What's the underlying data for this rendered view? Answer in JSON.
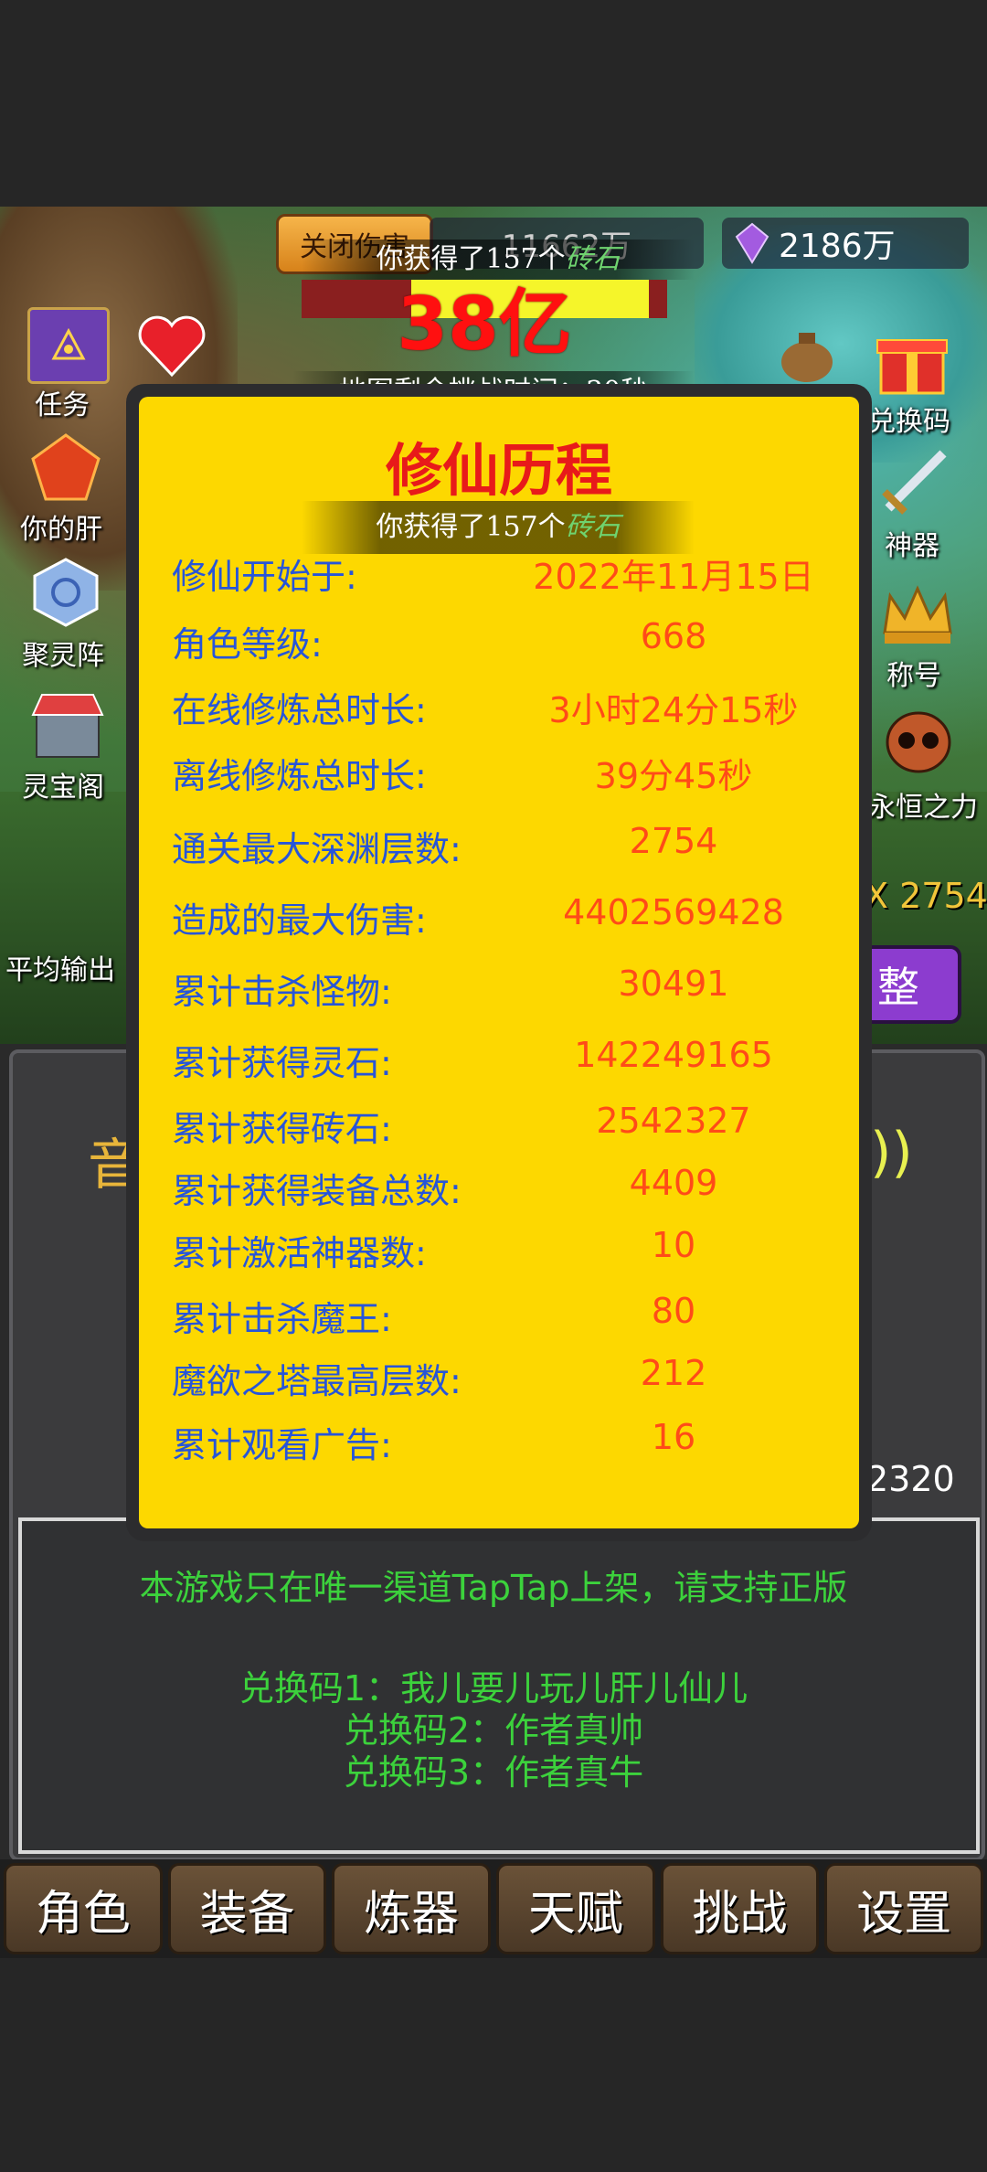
{
  "topbar": {
    "close_damage": "关闭伤害",
    "gold_value": "11662万",
    "gem_value": "2186万",
    "red_overlay_text": "38亿"
  },
  "toasts": {
    "gain_prefix": "你获得了157个",
    "gain_item": "砖石",
    "timer": "地图剩余挑战时间：30秒"
  },
  "left_menu": [
    {
      "label": "任务",
      "icon": "quest-book-icon"
    },
    {
      "label": "你的肝",
      "icon": "red-crystal-icon"
    },
    {
      "label": "聚灵阵",
      "icon": "spirit-array-icon"
    },
    {
      "label": "灵宝阁",
      "icon": "shop-icon"
    }
  ],
  "right_menu": [
    {
      "label": "兑换码",
      "icon": "gift-box-icon"
    },
    {
      "label": "神器",
      "icon": "sword-icon"
    },
    {
      "label": "称号",
      "icon": "crown-icon"
    },
    {
      "label": "永恒之力",
      "icon": "skull-icon"
    }
  ],
  "scene": {
    "avg_output": "平均输出",
    "layer_partial": "X 2754",
    "adjust_btn_partial": "整",
    "partial_number": "2320"
  },
  "modal": {
    "title": "修仙历程",
    "rows": [
      {
        "label": "修仙开始于:",
        "value": "2022年11月15日"
      },
      {
        "label": "角色等级:",
        "value": "668"
      },
      {
        "label": "在线修炼总时长:",
        "value": "3小时24分15秒"
      },
      {
        "label": "离线修炼总时长:",
        "value": "39分45秒"
      },
      {
        "label": "通关最大深渊层数:",
        "value": "2754"
      },
      {
        "label": "造成的最大伤害:",
        "value": "4402569428"
      },
      {
        "label": "累计击杀怪物:",
        "value": "30491"
      },
      {
        "label": "累计获得灵石:",
        "value": "142249165"
      },
      {
        "label": "累计获得砖石:",
        "value": "2542327"
      },
      {
        "label": "累计获得装备总数:",
        "value": "4409"
      },
      {
        "label": "累计激活神器数:",
        "value": "10"
      },
      {
        "label": "累计击杀魔王:",
        "value": "80"
      },
      {
        "label": "魔欲之塔最高层数:",
        "value": "212"
      },
      {
        "label": "累计观看广告:",
        "value": "16"
      }
    ]
  },
  "notice": {
    "line1": "本游戏只在唯一渠道TapTap上架，请支持正版",
    "code1": "兑换码1：我儿要儿玩儿肝儿仙儿",
    "code2": "兑换码2：作者真帅",
    "code3": "兑换码3：作者真牛"
  },
  "nav": [
    "角色",
    "装备",
    "炼器",
    "天赋",
    "挑战",
    "设置"
  ],
  "colors": {
    "modal_bg": "#fdd800",
    "label_blue": "#2755d9",
    "value_orange": "#ff4b18",
    "title_red": "#e81a1a",
    "notice_green": "#3cd23c"
  }
}
